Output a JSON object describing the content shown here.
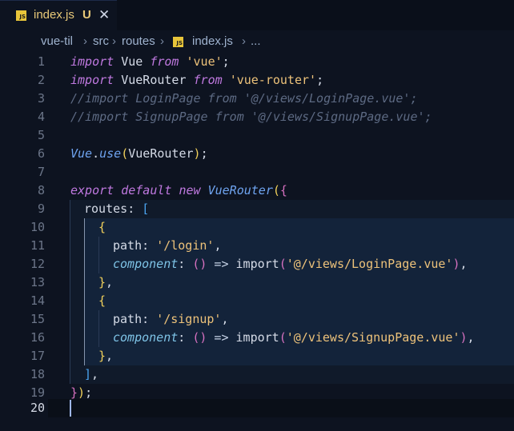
{
  "tab": {
    "icon": "JS",
    "label": "index.js",
    "status": "U",
    "close": "✕"
  },
  "breadcrumb": {
    "parts": [
      "vue-til",
      "src",
      "routes",
      "index.js",
      "..."
    ],
    "sep": "›",
    "file_icon": "JS"
  },
  "editor": {
    "line_numbers": [
      "1",
      "2",
      "3",
      "4",
      "5",
      "6",
      "7",
      "8",
      "9",
      "10",
      "11",
      "12",
      "13",
      "14",
      "15",
      "16",
      "17",
      "18",
      "19",
      "20"
    ],
    "active_line": "20"
  },
  "code": {
    "l1": [
      "import",
      " Vue ",
      "from",
      " ",
      "'vue'",
      ";"
    ],
    "l2": [
      "import",
      " VueRouter ",
      "from",
      " ",
      "'vue-router'",
      ";"
    ],
    "l3": "//import LoginPage from '@/views/LoginPage.vue';",
    "l4": "//import SignupPage from '@/views/SignupPage.vue';",
    "l6": [
      "Vue",
      ".",
      "use",
      "(",
      "VueRouter",
      ")",
      ";"
    ],
    "l8": [
      "export",
      " ",
      "default",
      " ",
      "new",
      " ",
      "VueRouter",
      "(",
      "{"
    ],
    "l9": [
      "routes",
      ": ",
      "["
    ],
    "l10": "{",
    "l11": [
      "path",
      ": ",
      "'/login'",
      ","
    ],
    "l12": [
      "component",
      ": ",
      "()",
      " => ",
      "import",
      "(",
      "'@/views/LoginPage.vue'",
      ")",
      ","
    ],
    "l13": [
      "}",
      ","
    ],
    "l14": "{",
    "l15": [
      "path",
      ": ",
      "'/signup'",
      ","
    ],
    "l16": [
      "component",
      ": ",
      "()",
      " => ",
      "import",
      "(",
      "'@/views/SignupPage.vue'",
      ")",
      ","
    ],
    "l17": [
      "}",
      ","
    ],
    "l18": [
      "]",
      ","
    ],
    "l19": [
      "}",
      ")",
      ";"
    ]
  }
}
